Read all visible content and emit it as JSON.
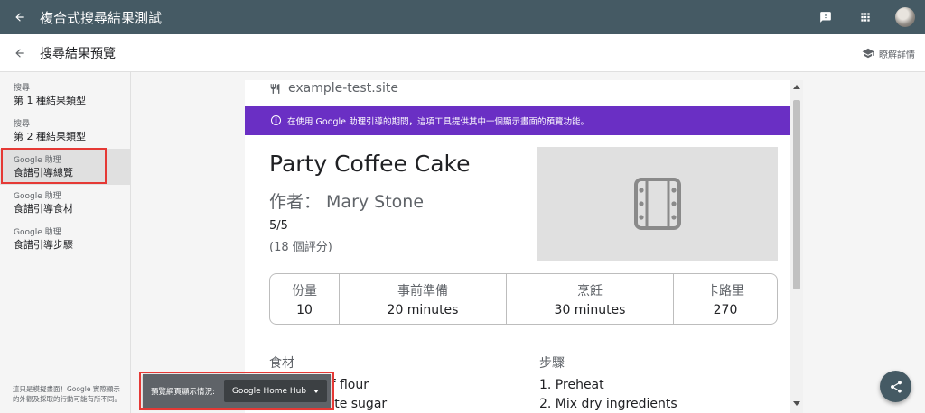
{
  "appbar": {
    "title": "複合式搜尋結果測試",
    "back_icon": "arrow-back-icon",
    "feedback_icon": "feedback-icon",
    "apps_icon": "apps-grid-icon"
  },
  "subbar": {
    "title": "搜尋結果預覽",
    "learn_more": "瞭解詳情",
    "learn_icon": "school-cap-icon"
  },
  "sidebar": {
    "items": [
      {
        "category": "搜尋",
        "label": "第 1 種結果類型",
        "active": false
      },
      {
        "category": "搜尋",
        "label": "第 2 種結果類型",
        "active": false
      },
      {
        "category": "Google 助理",
        "label": "食譜引導總覽",
        "active": true
      },
      {
        "category": "Google 助理",
        "label": "食譜引導食材",
        "active": false
      },
      {
        "category": "Google 助理",
        "label": "食譜引導步驟",
        "active": false
      }
    ],
    "disclaimer": "這只是模擬畫面！Google 實際顯示的外觀及採取的行動可能有所不同。"
  },
  "preview": {
    "site": "example-test.site",
    "site_icon": "fork-knife-icon",
    "banner": "在使用 Google 助理引導的期間，這項工具提供其中一個顯示畫面的預覽功能。",
    "banner_color": "#6a2fc4",
    "recipe": {
      "title": "Party Coffee Cake",
      "author": "作者： Mary Stone",
      "rating": "5/5",
      "rating_count": "(18 個評分)",
      "image_icon": "image-placeholder-icon"
    },
    "stats": [
      {
        "label": "份量",
        "value": "10"
      },
      {
        "label": "事前準備",
        "value": "20 minutes"
      },
      {
        "label": "烹飪",
        "value": "30 minutes"
      },
      {
        "label": "卡路里",
        "value": "270"
      }
    ],
    "ingredients_heading": "食材",
    "ingredients": [
      "of flour",
      "white sugar"
    ],
    "steps_heading": "步驟",
    "steps": [
      "1. Preheat",
      "2. Mix dry ingredients"
    ]
  },
  "device_picker": {
    "label": "預覽網頁顯示情況:",
    "selected": "Google Home Hub"
  },
  "fab": {
    "icon": "share-icon"
  },
  "colors": {
    "appbar": "#455a64",
    "highlight_outline": "#e53935"
  }
}
